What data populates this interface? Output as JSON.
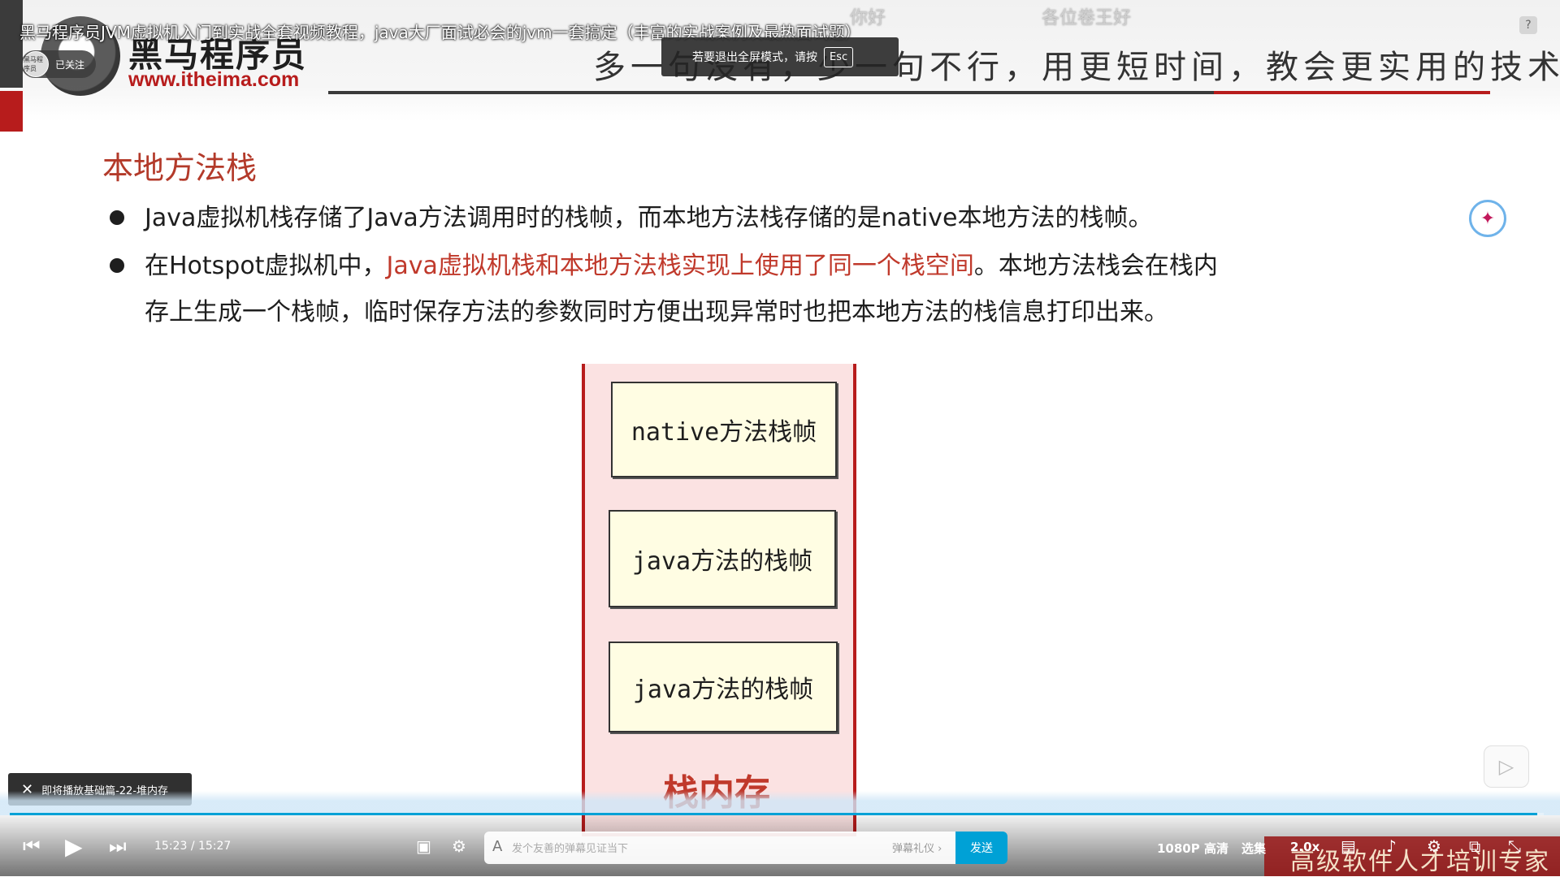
{
  "player": {
    "video_title": "黑马程序员JVM虚拟机入门到实战全套视频教程，java大厂面试必会的jvm一套搞定（丰富的实战案例及最热面试题）",
    "danmaku": [
      "你好",
      "各位卷王好"
    ],
    "help_label": "?",
    "follow_label": "已关注",
    "avatar_label": "黑马程序员",
    "esc_hint": "若要退出全屏模式，请按",
    "esc_key": "Esc",
    "next_episode": "即将播放基础篇-22-堆内存",
    "time_current": "15:23",
    "time_separator": "/",
    "time_total": "15:27",
    "progress_fraction": 0.9957,
    "danmaku_placeholder": "发个友善的弹幕见证当下",
    "danmaku_etiquette": "弹幕礼仪 ›",
    "send_label": "发送",
    "quality_label": "1080P 高清",
    "episodes_label": "选集",
    "speed_label": "2.0x"
  },
  "slide": {
    "logo_text": "黑马程序员",
    "logo_url": "www.itheima.com",
    "slogan": "多一句没有，少一句不行，用更短时间，教会更实用的技术!",
    "section_title": "本地方法栈",
    "bullet1": "Java虚拟机栈存储了Java方法调用时的栈帧，而本地方法栈存储的是native本地方法的栈帧。",
    "bullet2_pre": "在Hotspot虚拟机中，",
    "bullet2_red": "Java虚拟机栈和本地方法栈实现上使用了同一个栈空间",
    "bullet2_post": "。本地方法栈会在栈内",
    "bullet2_line2": "存上生成一个栈帧，临时保存方法的参数同时方便出现异常时也把本地方法的栈信息打印出来。",
    "frames": [
      "native方法栈帧",
      "java方法的栈帧",
      "java方法的栈帧"
    ],
    "stack_label": "栈内存",
    "footer_slogan": "高级软件人才培训专家"
  },
  "colors": {
    "accent_red": "#b71c1c",
    "title_red": "#b33a2a",
    "bili_blue": "#00a1d6",
    "frame_fill": "#fffde3",
    "stack_fill": "#fbe2e2"
  }
}
